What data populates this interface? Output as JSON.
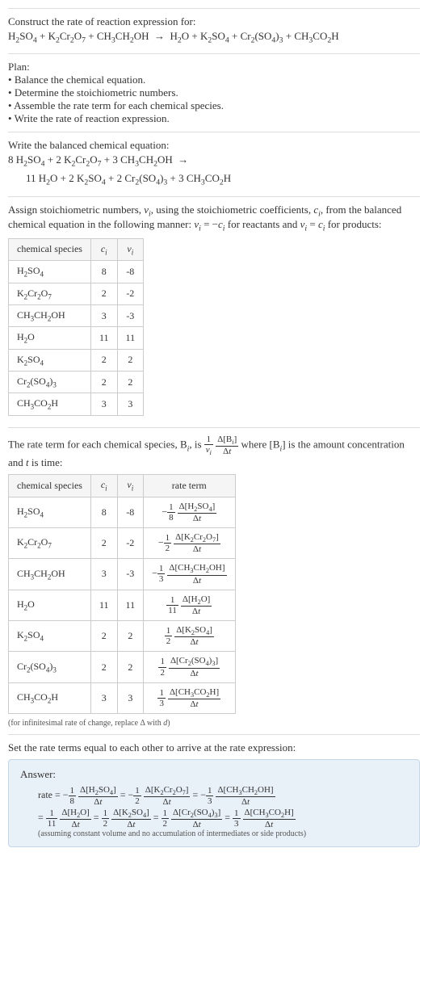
{
  "intro": {
    "prompt": "Construct the rate of reaction expression for:",
    "equation_html": "H<sub>2</sub>SO<sub>4</sub> + K<sub>2</sub>Cr<sub>2</sub>O<sub>7</sub> + CH<sub>3</sub>CH<sub>2</sub>OH &nbsp;&rarr;&nbsp; H<sub>2</sub>O + K<sub>2</sub>SO<sub>4</sub> + Cr<sub>2</sub>(SO<sub>4</sub>)<sub>3</sub> + CH<sub>3</sub>CO<sub>2</sub>H"
  },
  "plan": {
    "title": "Plan:",
    "items": [
      "Balance the chemical equation.",
      "Determine the stoichiometric numbers.",
      "Assemble the rate term for each chemical species.",
      "Write the rate of reaction expression."
    ]
  },
  "balanced": {
    "title": "Write the balanced chemical equation:",
    "lhs_html": "8 H<sub>2</sub>SO<sub>4</sub> + 2 K<sub>2</sub>Cr<sub>2</sub>O<sub>7</sub> + 3 CH<sub>3</sub>CH<sub>2</sub>OH &nbsp;&rarr;",
    "rhs_html": "11 H<sub>2</sub>O + 2 K<sub>2</sub>SO<sub>4</sub> + 2 Cr<sub>2</sub>(SO<sub>4</sub>)<sub>3</sub> + 3 CH<sub>3</sub>CO<sub>2</sub>H"
  },
  "stoich": {
    "intro_html": "Assign stoichiometric numbers, <span class='ital'>&nu;<sub>i</sub></span>, using the stoichiometric coefficients, <span class='ital'>c<sub>i</sub></span>, from the balanced chemical equation in the following manner: <span class='ital'>&nu;<sub>i</sub></span> = &minus;<span class='ital'>c<sub>i</sub></span> for reactants and <span class='ital'>&nu;<sub>i</sub></span> = <span class='ital'>c<sub>i</sub></span> for products:",
    "headers": {
      "species": "chemical species",
      "c": "c<sub>i</sub>",
      "nu": "&nu;<sub>i</sub>"
    },
    "rows": [
      {
        "species_html": "H<sub>2</sub>SO<sub>4</sub>",
        "c": "8",
        "nu": "-8"
      },
      {
        "species_html": "K<sub>2</sub>Cr<sub>2</sub>O<sub>7</sub>",
        "c": "2",
        "nu": "-2"
      },
      {
        "species_html": "CH<sub>3</sub>CH<sub>2</sub>OH",
        "c": "3",
        "nu": "-3"
      },
      {
        "species_html": "H<sub>2</sub>O",
        "c": "11",
        "nu": "11"
      },
      {
        "species_html": "K<sub>2</sub>SO<sub>4</sub>",
        "c": "2",
        "nu": "2"
      },
      {
        "species_html": "Cr<sub>2</sub>(SO<sub>4</sub>)<sub>3</sub>",
        "c": "2",
        "nu": "2"
      },
      {
        "species_html": "CH<sub>3</sub>CO<sub>2</sub>H",
        "c": "3",
        "nu": "3"
      }
    ]
  },
  "rateterm": {
    "intro_html": "The rate term for each chemical species, B<sub><span class='ital'>i</span></sub>, is <span class='frac'><span class='num'>1</span><span class='den'><span class='ital'>&nu;<sub>i</sub></span></span></span> <span class='frac'><span class='num'>&Delta;[B<sub><span class='ital'>i</span></sub>]</span><span class='den'>&Delta;<span class='ital'>t</span></span></span> where [B<sub><span class='ital'>i</span></sub>] is the amount concentration and <span class='ital'>t</span> is time:",
    "headers": {
      "species": "chemical species",
      "c": "c<sub>i</sub>",
      "nu": "&nu;<sub>i</sub>",
      "rate": "rate term"
    },
    "rows": [
      {
        "species_html": "H<sub>2</sub>SO<sub>4</sub>",
        "c": "8",
        "nu": "-8",
        "rate_html": "&minus;<span class='frac'><span class='num'>1</span><span class='den'>8</span></span> <span class='frac'><span class='num'>&Delta;[H<sub>2</sub>SO<sub>4</sub>]</span><span class='den'>&Delta;<span class='ital'>t</span></span></span>"
      },
      {
        "species_html": "K<sub>2</sub>Cr<sub>2</sub>O<sub>7</sub>",
        "c": "2",
        "nu": "-2",
        "rate_html": "&minus;<span class='frac'><span class='num'>1</span><span class='den'>2</span></span> <span class='frac'><span class='num'>&Delta;[K<sub>2</sub>Cr<sub>2</sub>O<sub>7</sub>]</span><span class='den'>&Delta;<span class='ital'>t</span></span></span>"
      },
      {
        "species_html": "CH<sub>3</sub>CH<sub>2</sub>OH",
        "c": "3",
        "nu": "-3",
        "rate_html": "&minus;<span class='frac'><span class='num'>1</span><span class='den'>3</span></span> <span class='frac'><span class='num'>&Delta;[CH<sub>3</sub>CH<sub>2</sub>OH]</span><span class='den'>&Delta;<span class='ital'>t</span></span></span>"
      },
      {
        "species_html": "H<sub>2</sub>O",
        "c": "11",
        "nu": "11",
        "rate_html": "<span class='frac'><span class='num'>1</span><span class='den'>11</span></span> <span class='frac'><span class='num'>&Delta;[H<sub>2</sub>O]</span><span class='den'>&Delta;<span class='ital'>t</span></span></span>"
      },
      {
        "species_html": "K<sub>2</sub>SO<sub>4</sub>",
        "c": "2",
        "nu": "2",
        "rate_html": "<span class='frac'><span class='num'>1</span><span class='den'>2</span></span> <span class='frac'><span class='num'>&Delta;[K<sub>2</sub>SO<sub>4</sub>]</span><span class='den'>&Delta;<span class='ital'>t</span></span></span>"
      },
      {
        "species_html": "Cr<sub>2</sub>(SO<sub>4</sub>)<sub>3</sub>",
        "c": "2",
        "nu": "2",
        "rate_html": "<span class='frac'><span class='num'>1</span><span class='den'>2</span></span> <span class='frac'><span class='num'>&Delta;[Cr<sub>2</sub>(SO<sub>4</sub>)<sub>3</sub>]</span><span class='den'>&Delta;<span class='ital'>t</span></span></span>"
      },
      {
        "species_html": "CH<sub>3</sub>CO<sub>2</sub>H",
        "c": "3",
        "nu": "3",
        "rate_html": "<span class='frac'><span class='num'>1</span><span class='den'>3</span></span> <span class='frac'><span class='num'>&Delta;[CH<sub>3</sub>CO<sub>2</sub>H]</span><span class='den'>&Delta;<span class='ital'>t</span></span></span>"
      }
    ],
    "footnote_html": "(for infinitesimal rate of change, replace &Delta; with <span class='ital'>d</span>)"
  },
  "final": {
    "intro": "Set the rate terms equal to each other to arrive at the rate expression:",
    "answer_label": "Answer:",
    "line1_html": "rate = &minus;<span class='frac'><span class='num'>1</span><span class='den'>8</span></span> <span class='frac'><span class='num'>&Delta;[H<sub>2</sub>SO<sub>4</sub>]</span><span class='den'>&Delta;<span class='ital'>t</span></span></span> = &minus;<span class='frac'><span class='num'>1</span><span class='den'>2</span></span> <span class='frac'><span class='num'>&Delta;[K<sub>2</sub>Cr<sub>2</sub>O<sub>7</sub>]</span><span class='den'>&Delta;<span class='ital'>t</span></span></span> = &minus;<span class='frac'><span class='num'>1</span><span class='den'>3</span></span> <span class='frac'><span class='num'>&Delta;[CH<sub>3</sub>CH<sub>2</sub>OH]</span><span class='den'>&Delta;<span class='ital'>t</span></span></span>",
    "line2_html": "= <span class='frac'><span class='num'>1</span><span class='den'>11</span></span> <span class='frac'><span class='num'>&Delta;[H<sub>2</sub>O]</span><span class='den'>&Delta;<span class='ital'>t</span></span></span> = <span class='frac'><span class='num'>1</span><span class='den'>2</span></span> <span class='frac'><span class='num'>&Delta;[K<sub>2</sub>SO<sub>4</sub>]</span><span class='den'>&Delta;<span class='ital'>t</span></span></span> = <span class='frac'><span class='num'>1</span><span class='den'>2</span></span> <span class='frac'><span class='num'>&Delta;[Cr<sub>2</sub>(SO<sub>4</sub>)<sub>3</sub>]</span><span class='den'>&Delta;<span class='ital'>t</span></span></span> = <span class='frac'><span class='num'>1</span><span class='den'>3</span></span> <span class='frac'><span class='num'>&Delta;[CH<sub>3</sub>CO<sub>2</sub>H]</span><span class='den'>&Delta;<span class='ital'>t</span></span></span>",
    "note": "(assuming constant volume and no accumulation of intermediates or side products)"
  }
}
